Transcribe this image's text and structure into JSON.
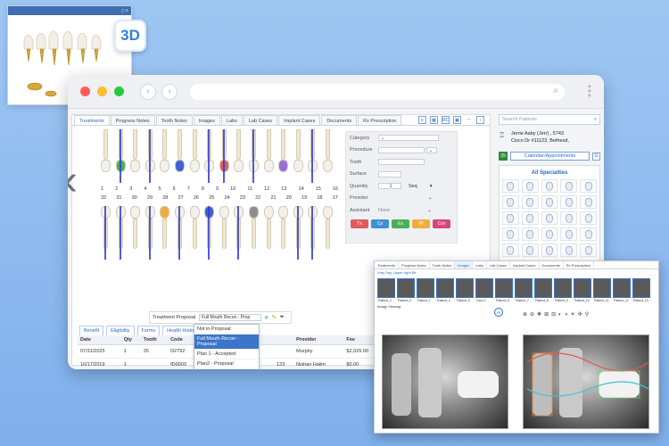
{
  "badge_3d": "3D",
  "tabs": [
    "Treatments",
    "Progress Notes",
    "Tooth Notes",
    "Images",
    "Labs",
    "Lab Cases",
    "Implant Cases",
    "Documents",
    "Rx Prescription"
  ],
  "toolbar": {
    "rc": "RC"
  },
  "tooth_numbers_upper": [
    "1",
    "2",
    "3",
    "4",
    "5",
    "6",
    "7",
    "8",
    "9",
    "10",
    "11",
    "12",
    "13",
    "14",
    "15",
    "16"
  ],
  "tooth_numbers_lower": [
    "32",
    "31",
    "30",
    "29",
    "28",
    "27",
    "26",
    "25",
    "24",
    "23",
    "22",
    "21",
    "20",
    "19",
    "18",
    "17"
  ],
  "form": {
    "labels": [
      "Category",
      "Procedure",
      "Tooth",
      "Surface",
      "Quantity",
      "Provider",
      "Assistant"
    ],
    "quantity_value": "1",
    "seq_label": "Seq",
    "assistant_value": "None",
    "buttons": [
      {
        "label": "Tx",
        "color": "#e25b5b"
      },
      {
        "label": "Cp",
        "color": "#3d8fd6"
      },
      {
        "label": "Ex",
        "color": "#4cae5a"
      },
      {
        "label": "Rf",
        "color": "#f0ad3c"
      },
      {
        "label": "Cxn",
        "color": "#d9467a"
      }
    ]
  },
  "proposal": {
    "label": "Treatment Proposal",
    "value": "Full Mouth Recon - Prop"
  },
  "dropdown": [
    "Not in Proposal",
    "Full Mouth Recon - Proposal",
    "Plan 1 - Accepted",
    "Plan2 - Proposal"
  ],
  "subtabs": [
    "Benefit",
    "Eligibility",
    "Forms",
    "Health History"
  ],
  "table": {
    "headers": [
      "Date",
      "Qty",
      "Tooth",
      "Code",
      "Surface",
      "Des",
      "",
      "Provider",
      "Fee",
      "Prod",
      "UCR",
      "Est"
    ],
    "rows": [
      [
        "07/31/2025",
        "1",
        "26",
        "D2792",
        "",
        "crow",
        "",
        "Murphy",
        "$2,029.00",
        "$2,029.00",
        "$2,046.00",
        "$0.00"
      ],
      [
        "10/17/2019",
        "1",
        "",
        "fD0003",
        "",
        "@@",
        "123",
        "Nishan Halim",
        "$0.00",
        "$0.00",
        "$440.00",
        "$0.00"
      ],
      [
        "08/12/2019",
        "1",
        "22",
        "D2140",
        "M",
        "amalgam -",
        "1",
        "Nishan Halim",
        "$277.00",
        "$277.00",
        "$277.00",
        "$0.00"
      ]
    ]
  },
  "sidebar": {
    "search_placeholder": "Search Patients",
    "patient_line1": "Jerrie Aaby (Jerr) , 5743",
    "patient_line2": "Cisco Dr #11123, Bethesd,",
    "cal_day": "29",
    "cal_button": "Calendar/Appointments",
    "g_button": "G",
    "specialties": "All Specialties"
  },
  "imaging": {
    "tabs": [
      "Treatments",
      "Progress Notes",
      "Tooth Notes",
      "Images",
      "Labs",
      "Lab Cases",
      "Implant Cases",
      "Documents",
      "Rx Prescription"
    ],
    "tag_label": "Xray Tag: Upper right Bk",
    "viewer_label": "Image Viewing",
    "ai_label": "AI",
    "thumbs": [
      "Patient_4",
      "Patient_5",
      "Patient_1",
      "Patient_2",
      "Patient_3",
      "Card 1",
      "Patient_6",
      "Patient_7",
      "Patient_8",
      "Patient_9",
      "Patient_10",
      "Patient_11",
      "Patient_12",
      "Patient_13"
    ]
  }
}
